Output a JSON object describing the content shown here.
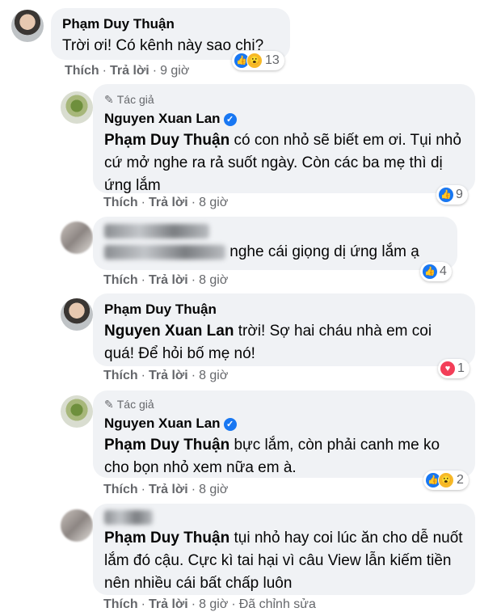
{
  "comments": [
    {
      "name": "Phạm Duy Thuận",
      "text": "Trời ơi! Có kênh này sao chị?",
      "actions": {
        "like": "Thích",
        "reply": "Trả lời",
        "time": "9 giờ"
      },
      "reaction_count": "13"
    },
    {
      "author_tag": "Tác giả",
      "name": "Nguyen Xuan Lan",
      "mention": "Phạm Duy Thuận",
      "text": "có con nhỏ sẽ biết em ơi. Tụi nhỏ cứ mở nghe ra rả suốt ngày. Còn các ba mẹ thì dị ứng lắm",
      "actions": {
        "like": "Thích",
        "reply": "Trả lời",
        "time": "8 giờ"
      },
      "reaction_count": "9"
    },
    {
      "text": "nghe cái giọng dị ứng lắm ạ",
      "actions": {
        "like": "Thích",
        "reply": "Trả lời",
        "time": "8 giờ"
      },
      "reaction_count": "4"
    },
    {
      "name": "Phạm Duy Thuận",
      "mention": "Nguyen Xuan Lan",
      "text": "trời! Sợ hai cháu nhà em coi quá! Để hỏi bố mẹ nó!",
      "actions": {
        "like": "Thích",
        "reply": "Trả lời",
        "time": "8 giờ"
      },
      "reaction_count": "1"
    },
    {
      "author_tag": "Tác giả",
      "name": "Nguyen Xuan Lan",
      "mention": "Phạm Duy Thuận",
      "text": "bực lắm, còn phải canh me ko cho bọn nhỏ xem nữa em à.",
      "actions": {
        "like": "Thích",
        "reply": "Trả lời",
        "time": "8 giờ"
      },
      "reaction_count": "2"
    },
    {
      "mention": "Phạm Duy Thuận",
      "text": "tụi nhỏ hay coi lúc ăn cho dễ nuốt lắm đó cậu. Cực kì tai hại vì câu View lẫn kiếm tiền nên nhiều cái bất chấp luôn",
      "actions": {
        "like": "Thích",
        "reply": "Trả lời",
        "time": "8 giờ",
        "edited": "Đã chỉnh sửa"
      },
      "reaction_count": ""
    }
  ],
  "colors": {
    "bubble": "#f0f2f5",
    "like": "#1877f2",
    "heart": "#f33e58",
    "wow": "#f7b928",
    "meta": "#65676b"
  }
}
